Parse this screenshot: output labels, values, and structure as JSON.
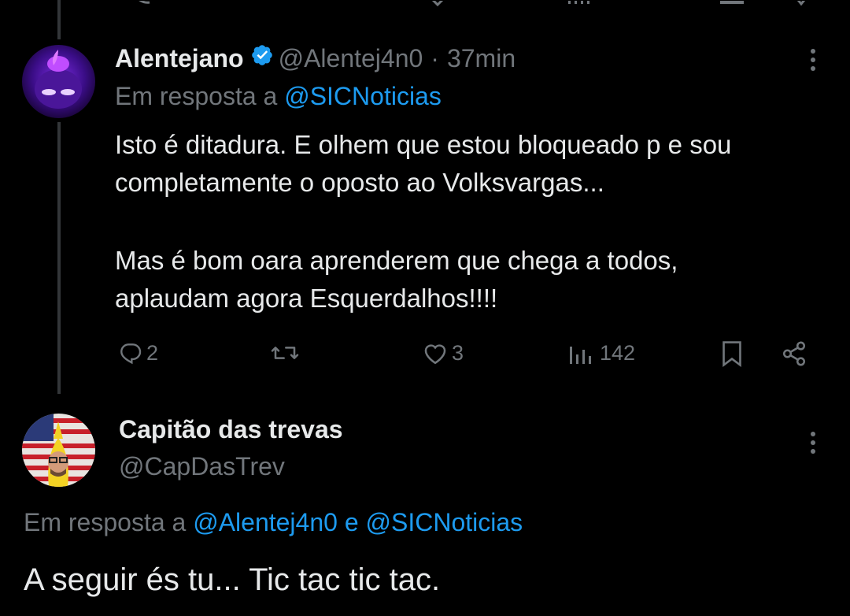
{
  "tweet1": {
    "author_name": "Alentejano",
    "handle": "@Alentej4n0",
    "separator": "·",
    "time": "37min",
    "reply_prefix": "Em resposta a",
    "reply_to": "@SICNoticias",
    "text_lines": [
      "Isto é ditadura. E olhem que estou bloqueado p e sou",
      "completamente o oposto ao Volksvargas...",
      "Mas é bom oara aprenderem que chega a todos,",
      "aplaudam agora Esquerdalhos!!!!"
    ],
    "actions": {
      "replies": "2",
      "retweets": "",
      "likes": "3",
      "views": "142"
    }
  },
  "tweet2": {
    "author_name": "Capitão das trevas",
    "handle": "@CapDasTrev",
    "reply_prefix": "Em resposta a",
    "reply_to_1": "@Alentej4n0",
    "reply_conj": "e",
    "reply_to_2": "@SICNoticias",
    "text": "A seguir és tu... Tic tac tic tac."
  },
  "colors": {
    "background": "#000000",
    "text": "#e7e9ea",
    "secondary": "#71767b",
    "link": "#1d9bf0",
    "verified": "#1d9bf0"
  },
  "icons": [
    "verified-badge-icon",
    "more-icon",
    "reply-icon",
    "retweet-icon",
    "like-icon",
    "views-icon",
    "bookmark-icon",
    "share-icon"
  ]
}
